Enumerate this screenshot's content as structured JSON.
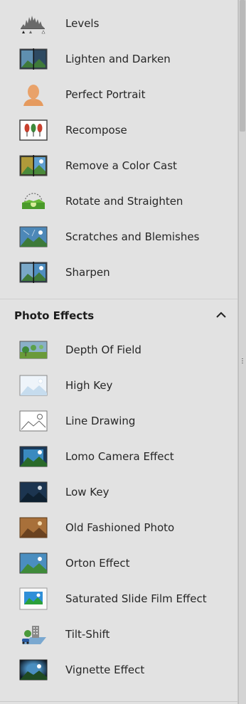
{
  "top_items": [
    {
      "label": "Levels",
      "icon": "levels-icon"
    },
    {
      "label": "Lighten and Darken",
      "icon": "lighten-darken-icon"
    },
    {
      "label": "Perfect Portrait",
      "icon": "portrait-icon"
    },
    {
      "label": "Recompose",
      "icon": "recompose-icon"
    },
    {
      "label": "Remove a Color Cast",
      "icon": "color-cast-icon"
    },
    {
      "label": "Rotate and Straighten",
      "icon": "rotate-straighten-icon"
    },
    {
      "label": "Scratches and Blemishes",
      "icon": "scratches-icon"
    },
    {
      "label": "Sharpen",
      "icon": "sharpen-icon"
    }
  ],
  "section": {
    "title": "Photo Effects",
    "items": [
      {
        "label": "Depth Of Field",
        "icon": "depth-of-field-icon"
      },
      {
        "label": "High Key",
        "icon": "high-key-icon"
      },
      {
        "label": "Line Drawing",
        "icon": "line-drawing-icon"
      },
      {
        "label": "Lomo Camera Effect",
        "icon": "lomo-icon"
      },
      {
        "label": "Low Key",
        "icon": "low-key-icon"
      },
      {
        "label": "Old Fashioned Photo",
        "icon": "old-fashioned-icon"
      },
      {
        "label": "Orton Effect",
        "icon": "orton-icon"
      },
      {
        "label": "Saturated Slide Film Effect",
        "icon": "saturated-slide-icon"
      },
      {
        "label": "Tilt-Shift",
        "icon": "tilt-shift-icon"
      },
      {
        "label": "Vignette Effect",
        "icon": "vignette-icon"
      }
    ]
  }
}
